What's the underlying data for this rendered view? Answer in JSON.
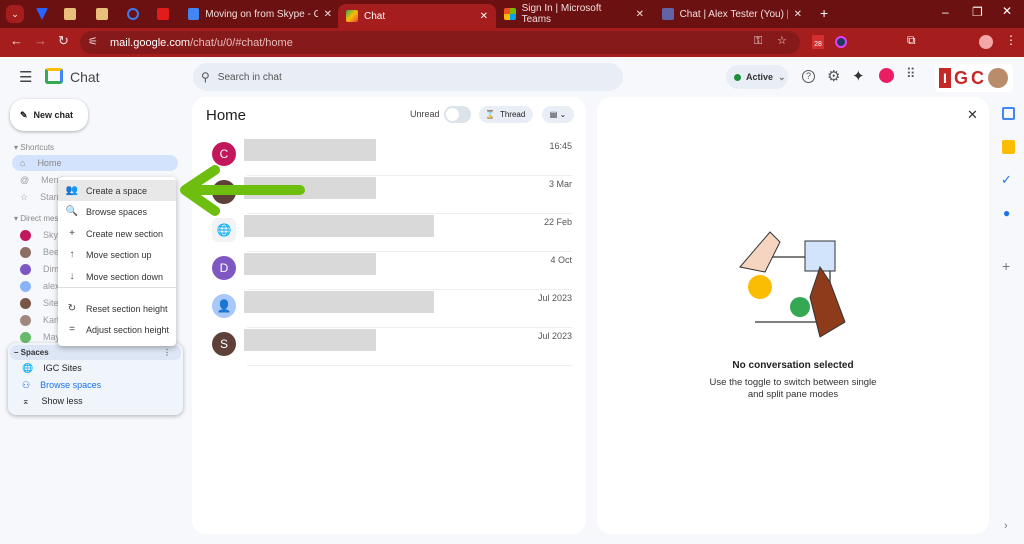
{
  "browser": {
    "tabs": [
      {
        "title": "Moving on from Skype - Google Docs",
        "active": false
      },
      {
        "title": "Chat",
        "active": true
      },
      {
        "title": "Sign In | Microsoft Teams",
        "active": false
      },
      {
        "title": "Chat | Alex Tester (You) | Microsoft Teams",
        "active": false
      }
    ],
    "url_host": "mail.google.com",
    "url_path": "/chat/u/0/#chat/home",
    "ext_badge": "28"
  },
  "app": {
    "name": "Chat",
    "search_placeholder": "Search in chat",
    "status": "Active",
    "logo_text": "IGC"
  },
  "sidebar": {
    "new_chat": "New chat",
    "shortcuts_header": "Shortcuts",
    "shortcuts": [
      {
        "label": "Home",
        "icon": "home-icon"
      },
      {
        "label": "Mentions",
        "icon": "at-icon"
      },
      {
        "label": "Starred",
        "icon": "star-icon"
      }
    ],
    "dm_header": "Direct messages",
    "dms": [
      {
        "label": "Skype",
        "color": "#c2185b"
      },
      {
        "label": "Beer",
        "color": "#8d6e63"
      },
      {
        "label": "Dima",
        "color": "#7e57c2"
      },
      {
        "label": "alex",
        "color": "#8ab4f8"
      },
      {
        "label": "Sites",
        "color": "#795548"
      },
      {
        "label": "Karl",
        "color": "#a1887f"
      },
      {
        "label": "May",
        "color": "#66bb6a"
      }
    ],
    "spaces_header": "Spaces",
    "spaces": [
      {
        "label": "IGC Sites",
        "icon": "globe-icon"
      },
      {
        "label": "Browse spaces",
        "icon": "browse-spaces-icon"
      },
      {
        "label": "Show less",
        "icon": "collapse-icon"
      }
    ]
  },
  "context_menu": [
    {
      "label": "Create a space",
      "icon": "👥"
    },
    {
      "label": "Browse spaces",
      "icon": "🔍"
    },
    {
      "label": "Create new section",
      "icon": "+"
    },
    {
      "label": "Move section up",
      "icon": "↑"
    },
    {
      "label": "Move section down",
      "icon": "↓"
    },
    {
      "label": "Reset section height",
      "icon": "↻"
    },
    {
      "label": "Adjust section height",
      "icon": "="
    }
  ],
  "home": {
    "title": "Home",
    "unread_label": "Unread",
    "unread_on": false,
    "thread_label": "Thread",
    "conversations": [
      {
        "initial": "C",
        "color": "#c2185b",
        "time": "16:45"
      },
      {
        "initial": "",
        "color": "#5d4037",
        "time": "3 Mar"
      },
      {
        "initial": "🌐",
        "color": "#f1f3f4",
        "time": "22 Feb"
      },
      {
        "initial": "D",
        "color": "#7e57c2",
        "time": "4 Oct"
      },
      {
        "initial": "👤",
        "color": "#a8c7fa",
        "time": "Jul 2023"
      },
      {
        "initial": "S",
        "color": "#5d4037",
        "time": "Jul 2023"
      }
    ]
  },
  "detail": {
    "title": "No conversation selected",
    "subtitle": "Use the toggle to switch between single and split pane modes"
  },
  "colors": {
    "tabbar": "#6b1111",
    "toolbar": "#a51d1d",
    "arrow": "#6ebe0f",
    "active": "#1e8e3e"
  }
}
